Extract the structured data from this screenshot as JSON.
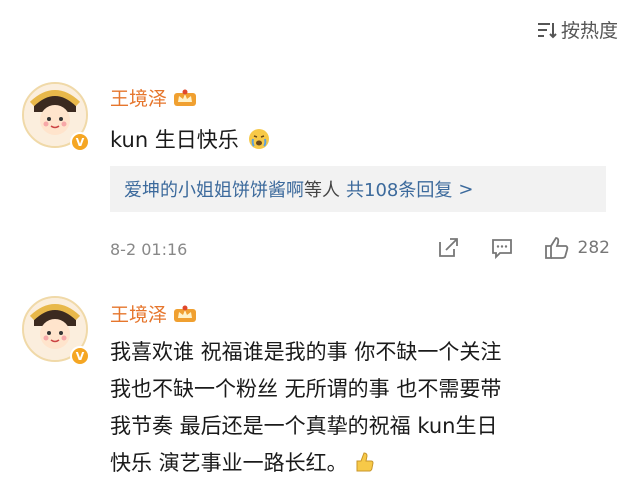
{
  "sort": {
    "label": "按热度"
  },
  "comments": [
    {
      "username": "王境泽",
      "text": "kun 生日快乐",
      "reply": {
        "names": "爱坤的小姐姐饼饼酱啊",
        "suffix": "等人",
        "count": "共108条回复",
        "arrow": ">"
      },
      "time": "8-2 01:16",
      "likes": "282"
    },
    {
      "username": "王境泽",
      "lines": [
        "我喜欢谁 祝福谁是我的事 你不缺一个关注",
        "我也不缺一个粉丝 无所谓的事 也不需要带",
        "我节奏 最后还是一个真挚的祝福 kun生日",
        "快乐 演艺事业一路长红。"
      ]
    }
  ],
  "colors": {
    "username": "#e6762d",
    "link": "#3c6a9c",
    "meta": "#888888",
    "reply_bg": "#f2f2f2"
  }
}
